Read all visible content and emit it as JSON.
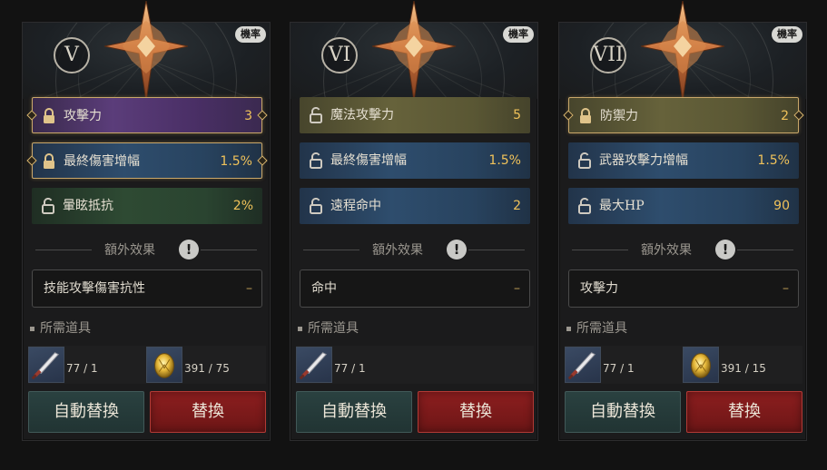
{
  "panels": [
    {
      "numeral": "V",
      "prob_badge": "機率",
      "stats": [
        {
          "label": "攻擊力",
          "value": "3",
          "locked": true,
          "color": "#5b3d7a"
        },
        {
          "label": "最終傷害增幅",
          "value": "1.5%",
          "locked": true,
          "color": "#2e4d6d"
        },
        {
          "label": "暈眩抵抗",
          "value": "2%",
          "locked": false,
          "color": "#2e4a33"
        }
      ],
      "extra_title": "額外效果",
      "extra_effect": {
        "label": "技能攻擊傷害抗性",
        "value": "–"
      },
      "required_title": "所需道具",
      "items": [
        {
          "icon": "blade-item-icon",
          "count": "77 / 1"
        },
        {
          "icon": "gold-egg-item-icon",
          "count": "391 / 75"
        }
      ],
      "auto_button": "自動替換",
      "swap_button": "替換"
    },
    {
      "numeral": "VI",
      "prob_badge": "機率",
      "stats": [
        {
          "label": "魔法攻擊力",
          "value": "5",
          "locked": false,
          "color": "#66623b"
        },
        {
          "label": "最終傷害增幅",
          "value": "1.5%",
          "locked": false,
          "color": "#2e4d6d"
        },
        {
          "label": "遠程命中",
          "value": "2",
          "locked": false,
          "color": "#2e4d6d"
        }
      ],
      "extra_title": "額外效果",
      "extra_effect": {
        "label": "命中",
        "value": "–"
      },
      "required_title": "所需道具",
      "items": [
        {
          "icon": "blade-item-icon",
          "count": "77 / 1"
        }
      ],
      "auto_button": "自動替換",
      "swap_button": "替換"
    },
    {
      "numeral": "VII",
      "prob_badge": "機率",
      "stats": [
        {
          "label": "防禦力",
          "value": "2",
          "locked": true,
          "color": "#66623b"
        },
        {
          "label": "武器攻擊力增幅",
          "value": "1.5%",
          "locked": false,
          "color": "#2e4d6d"
        },
        {
          "label": "最大HP",
          "value": "90",
          "locked": false,
          "color": "#2e4d6d"
        }
      ],
      "extra_title": "額外效果",
      "extra_effect": {
        "label": "攻擊力",
        "value": "–"
      },
      "required_title": "所需道具",
      "items": [
        {
          "icon": "blade-item-icon",
          "count": "77 / 1"
        },
        {
          "icon": "gold-egg-item-icon",
          "count": "391 / 15"
        }
      ],
      "auto_button": "自動替換",
      "swap_button": "替換"
    }
  ]
}
